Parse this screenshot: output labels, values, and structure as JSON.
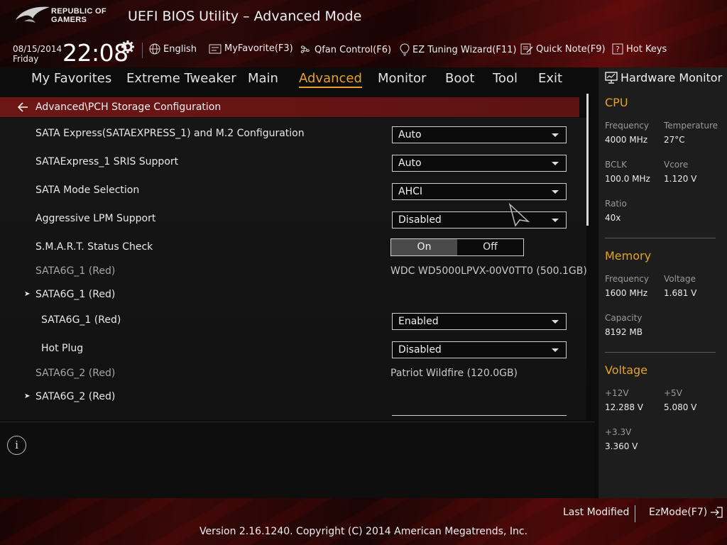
{
  "brand": {
    "line1": "REPUBLIC OF",
    "line2": "GAMERS",
    "app_title": "UEFI BIOS Utility – Advanced Mode"
  },
  "clock": {
    "date": "08/15/2014",
    "day": "Friday",
    "time": "22:08"
  },
  "toolbar": {
    "language": "English",
    "favorite": "MyFavorite(F3)",
    "qfan": "Qfan Control(F6)",
    "ez_tuning": "EZ Tuning Wizard(F11)",
    "quick_note": "Quick Note(F9)",
    "hot_keys": "Hot Keys"
  },
  "tabs": [
    {
      "label": "My Favorites"
    },
    {
      "label": "Extreme Tweaker"
    },
    {
      "label": "Main"
    },
    {
      "label": "Advanced"
    },
    {
      "label": "Monitor"
    },
    {
      "label": "Boot"
    },
    {
      "label": "Tool"
    },
    {
      "label": "Exit"
    }
  ],
  "active_tab": "Advanced",
  "breadcrumb": "Advanced\\PCH Storage Configuration",
  "settings": {
    "sata_express_m2": {
      "label": "SATA Express(SATAEXPRESS_1) and M.2 Configuration",
      "value": "Auto"
    },
    "srise": {
      "label": "SATAExpress_1 SRIS Support",
      "value": "Auto"
    },
    "sata_mode": {
      "label": "SATA Mode Selection",
      "value": "AHCI"
    },
    "lpm": {
      "label": "Aggressive LPM Support",
      "value": "Disabled"
    },
    "smart": {
      "label": "S.M.A.R.T. Status Check",
      "on": "On",
      "off": "Off",
      "selected": "On"
    },
    "sata6g1_info": {
      "label": "SATA6G_1 (Red)",
      "value": "WDC WD5000LPVX-00V0TT0 (500.1GB)"
    },
    "sata6g1_group": {
      "label": "SATA6G_1 (Red)"
    },
    "sata6g1_port": {
      "label": "SATA6G_1 (Red)",
      "value": "Enabled"
    },
    "sata6g1_hotplug": {
      "label": "Hot Plug",
      "value": "Disabled"
    },
    "sata6g2_info": {
      "label": "SATA6G_2 (Red)",
      "value": "Patriot Wildfire (120.0GB)"
    },
    "sata6g2_group": {
      "label": "SATA6G_2 (Red)"
    }
  },
  "hardware_monitor": {
    "title": "Hardware Monitor",
    "cpu": {
      "heading": "CPU",
      "frequency_label": "Frequency",
      "frequency": "4000 MHz",
      "temperature_label": "Temperature",
      "temperature": "27°C",
      "bclk_label": "BCLK",
      "bclk": "100.0 MHz",
      "vcore_label": "Vcore",
      "vcore": "1.120 V",
      "ratio_label": "Ratio",
      "ratio": "40x"
    },
    "memory": {
      "heading": "Memory",
      "frequency_label": "Frequency",
      "frequency": "1600 MHz",
      "voltage_label": "Voltage",
      "voltage": "1.681 V",
      "capacity_label": "Capacity",
      "capacity": "8192 MB"
    },
    "voltage": {
      "heading": "Voltage",
      "v12_label": "+12V",
      "v12": "12.288 V",
      "v5_label": "+5V",
      "v5": "5.080 V",
      "v33_label": "+3.3V",
      "v33": "3.360 V"
    }
  },
  "footer": {
    "last_modified": "Last Modified",
    "ezmode": "EzMode(F7)",
    "version": "Version 2.16.1240. Copyright (C) 2014 American Megatrends, Inc."
  },
  "colors": {
    "accent": "#e8a21f",
    "breadcrumb_bg": "#6a1515"
  }
}
